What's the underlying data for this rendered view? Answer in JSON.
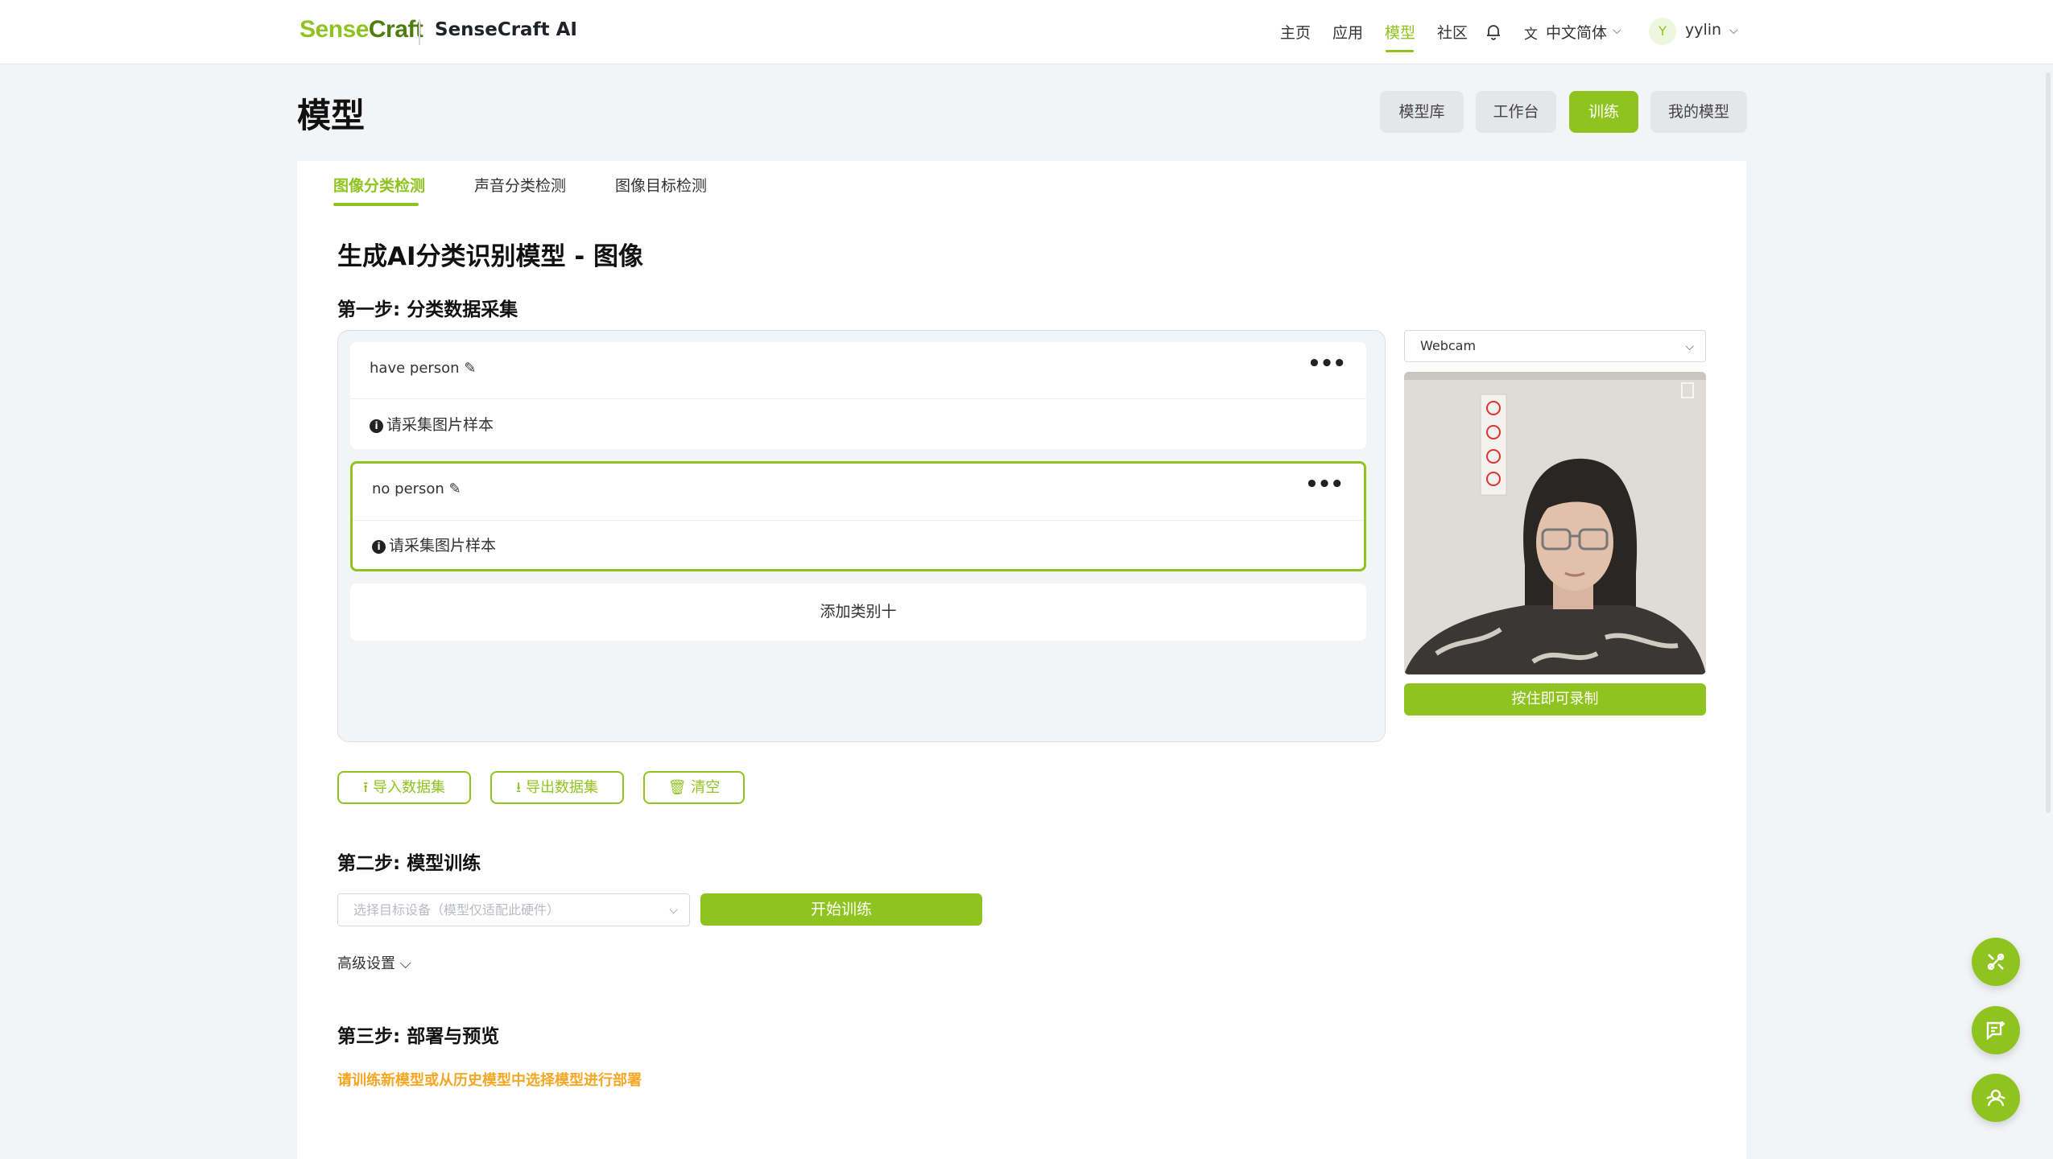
{
  "header": {
    "logo": {
      "part1": "Sense",
      "part2": "Craft"
    },
    "app_name": "SenseCraft AI",
    "nav": [
      "主页",
      "应用",
      "模型",
      "社区"
    ],
    "language": "中文简体",
    "user_initial": "Y",
    "username": "yylin"
  },
  "page": {
    "title": "模型",
    "top_tabs": [
      "模型库",
      "工作台",
      "训练",
      "我的模型"
    ],
    "active_top_tab": "训练"
  },
  "sub_tabs": [
    "图像分类检测",
    "声音分类检测",
    "图像目标检测"
  ],
  "main": {
    "heading": "生成AI分类识别模型 - 图像",
    "step1": "第一步: 分类数据采集",
    "classes": [
      {
        "name": "have person",
        "hint": "请采集图片样本"
      },
      {
        "name": "no person",
        "hint": "请采集图片样本"
      }
    ],
    "add_class": "添加类别十",
    "webcam_select": "Webcam",
    "record_btn": "按住即可录制",
    "buttons": {
      "import": "导入数据集",
      "export": "导出数据集",
      "clear": "清空"
    },
    "step2": "第二步: 模型训练",
    "device_placeholder": "选择目标设备（模型仅适配此硬件）",
    "train_btn": "开始训练",
    "advanced": "高级设置",
    "step3": "第三步: 部署与预览",
    "warning": "请训练新模型或从历史模型中选择模型进行部署"
  },
  "colors": {
    "accent": "#8fc31f",
    "warning": "#f5a623"
  }
}
